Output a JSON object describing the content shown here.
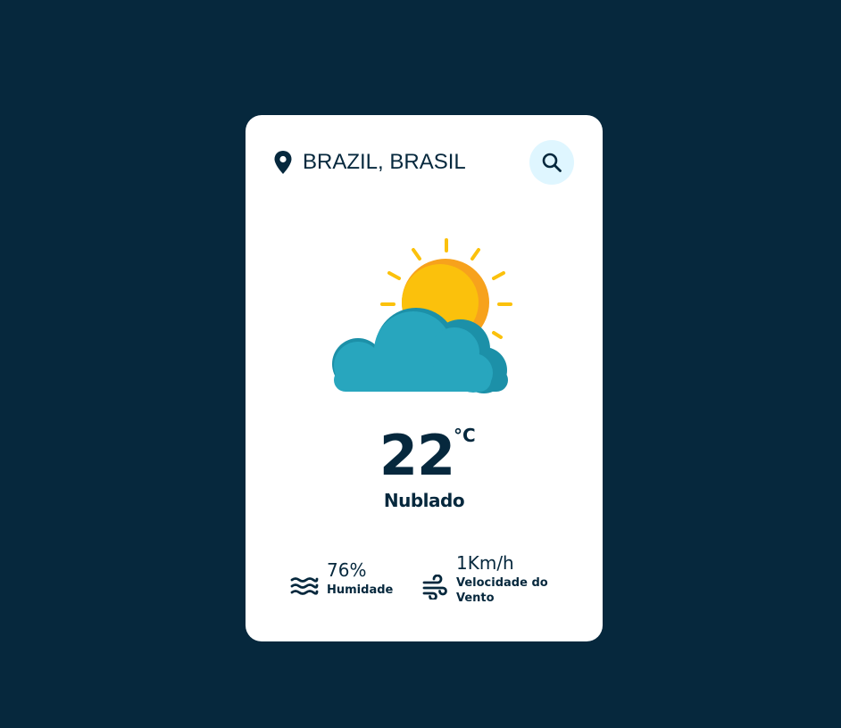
{
  "search": {
    "value": "BRAZIL, BRASIL",
    "icon": "search-icon"
  },
  "location_icon": "location-pin-icon",
  "weather": {
    "icon": "partly-cloudy-icon",
    "temperature": "22",
    "unit": "°C",
    "description": "Nublado"
  },
  "details": {
    "humidity": {
      "icon": "waves-icon",
      "value": "76%",
      "label": "Humidade"
    },
    "wind": {
      "icon": "wind-icon",
      "value": "1Km/h",
      "label": "Velocidade do Vento"
    }
  },
  "colors": {
    "background": "#06283d",
    "card": "#ffffff",
    "text": "#06283d",
    "search_button": "#dff6ff",
    "sun": "#fbc10c",
    "sun_shade": "#f7a21c",
    "cloud": "#28a6be",
    "cloud_shade": "#1c90a8"
  }
}
